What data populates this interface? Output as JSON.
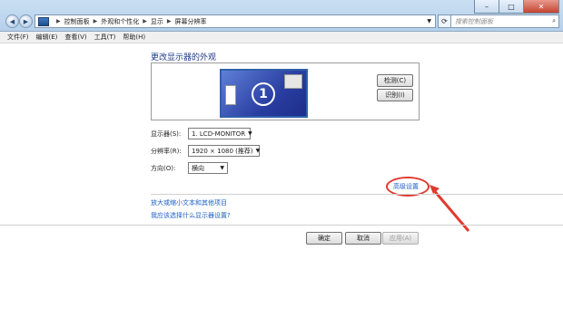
{
  "window": {
    "minimize": "–",
    "maximize": "□",
    "close": "✕"
  },
  "breadcrumb": [
    "控制面板",
    "外观和个性化",
    "显示",
    "屏幕分辨率"
  ],
  "search": {
    "placeholder": "搜索控制面板"
  },
  "menu": [
    "文件(F)",
    "编辑(E)",
    "查看(V)",
    "工具(T)",
    "帮助(H)"
  ],
  "main": {
    "title": "更改显示器的外观",
    "monitor_number": "1",
    "detect_button": "检测(C)",
    "identify_button": "识别(I)",
    "display_label": "显示器(S):",
    "display_value": "1. LCD-MONITOR",
    "resolution_label": "分辨率(R):",
    "resolution_value": "1920 × 1080 (推荐)",
    "orientation_label": "方向(O):",
    "orientation_value": "横向",
    "advanced_link": "高级设置",
    "link_text_size": "放大或缩小文本和其他项目",
    "link_help": "我应该选择什么显示器设置?",
    "ok": "确定",
    "cancel": "取消",
    "apply": "应用(A)"
  },
  "colors": {
    "link": "#1d5fc4",
    "title": "#1e3a8a",
    "annotation": "#e03a2f"
  }
}
